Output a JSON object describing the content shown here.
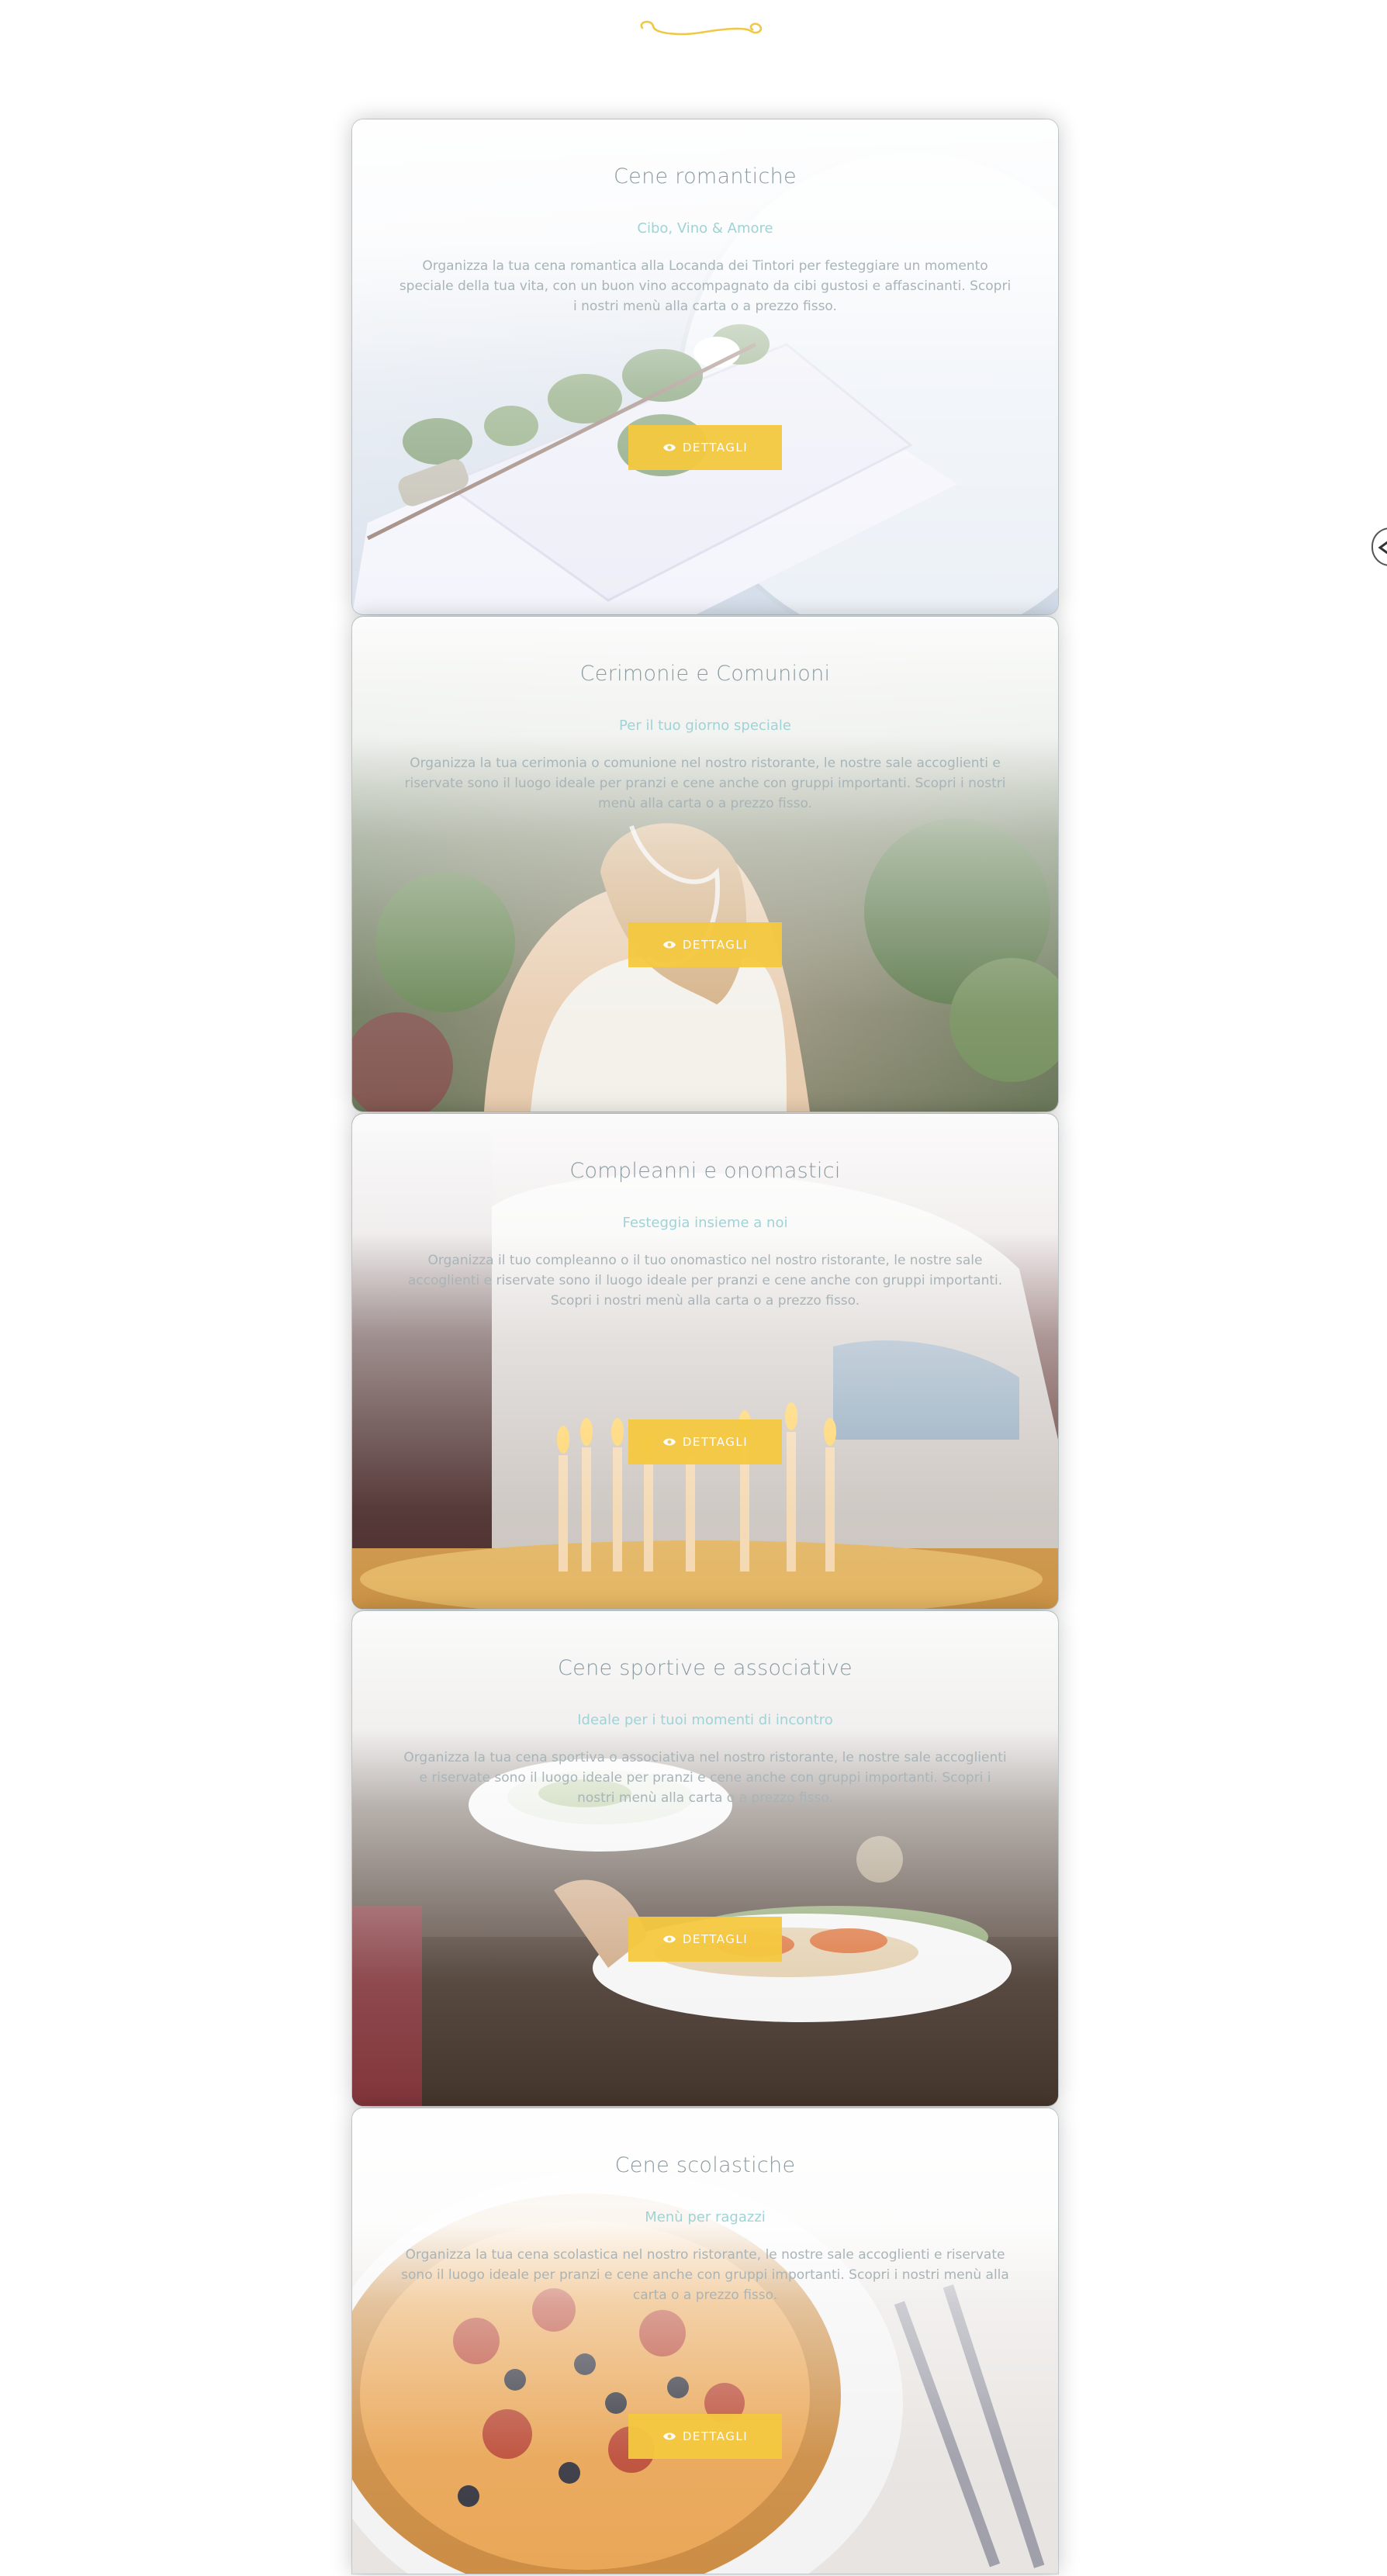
{
  "cards": [
    {
      "title": "Cene romantiche",
      "subtitle": "Cibo, Vino & Amore",
      "text": "Organizza la tua cena romantica alla Locanda dei Tintori per festeggiare un momento speciale della tua vita, con un buon vino accompagnato da cibi gustosi e affascinanti. Scopri i nostri menù alla carta o a prezzo fisso.",
      "button": "DETTAGLI",
      "button_icon": "eye-icon",
      "image": "napkin-and-rose-place-setting"
    },
    {
      "title": "Cerimonie e Comunioni",
      "subtitle": "Per il tuo giorno speciale",
      "text": "Organizza la tua cerimonia o comunione nel nostro ristorante, le nostre sale accoglienti e riservate sono il luogo ideale per pranzi e cene anche con gruppi importanti. Scopri i nostri menù alla carta o a prezzo fisso.",
      "button": "DETTAGLI",
      "button_icon": "eye-icon",
      "image": "girl-with-veil-in-garden"
    },
    {
      "title": "Compleanni e onomastici",
      "subtitle": "Festeggia insieme a noi",
      "text": "Organizza il tuo compleanno o il tuo onomastico nel nostro ristorante, le nostre sale accoglienti e riservate sono il luogo ideale per pranzi e cene anche con gruppi importanti. Scopri i nostri menù alla carta o a prezzo fisso.",
      "button": "DETTAGLI",
      "button_icon": "eye-icon",
      "image": "birthday-cake-candles"
    },
    {
      "title": "Cene sportive e associative",
      "subtitle": "Ideale per i tuoi momenti di incontro",
      "text": "Organizza la tua cena sportiva o associativa nel nostro ristorante, le nostre sale accoglienti e riservate sono il luogo ideale per pranzi e cene anche con gruppi importanti. Scopri i nostri menù alla carta o a prezzo fisso.",
      "button": "DETTAGLI",
      "button_icon": "eye-icon",
      "image": "waiter-serving-plates"
    },
    {
      "title": "Cene scolastiche",
      "subtitle": "Menù per ragazzi",
      "text": "Organizza la tua cena scolastica nel nostro ristorante, le nostre sale accoglienti e riservate sono il luogo ideale per pranzi e cene anche con gruppi importanti. Scopri i nostri menù alla carta o a prezzo fisso.",
      "button": "DETTAGLI",
      "button_icon": "eye-icon",
      "image": "pizza-with-olives"
    }
  ],
  "colors": {
    "accent": "#f5c940",
    "subtitle": "#9fd3d6",
    "title": "#8a9aa0",
    "text": "#a8b4b8"
  },
  "side_control": {
    "icon": "arrow-left-icon"
  },
  "ornament": {
    "icon": "swirl-divider-icon"
  }
}
